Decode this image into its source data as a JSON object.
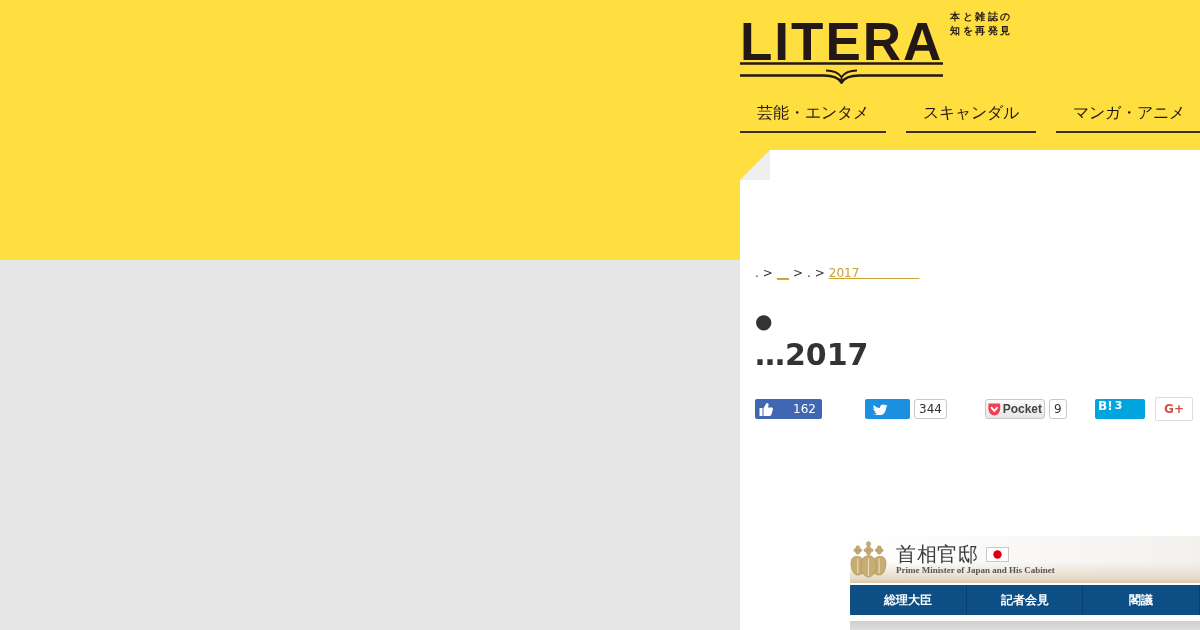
{
  "header": {
    "logo": {
      "text": "LITERA",
      "tagline": "本と雑誌の知を再発見"
    },
    "nav": [
      {
        "label": "芸能・エンタメ"
      },
      {
        "label": "スキャンダル"
      },
      {
        "label": "マンガ・アニメ"
      }
    ]
  },
  "article": {
    "breadcrumb": [
      {
        "kind": "text",
        "text": "."
      },
      {
        "kind": "separator",
        "text": ">"
      },
      {
        "kind": "link",
        "text": "__"
      },
      {
        "kind": "separator",
        "text": ">"
      },
      {
        "kind": "text",
        "text": "."
      },
      {
        "kind": "separator",
        "text": ">"
      },
      {
        "kind": "link",
        "text": "2017　　　　　"
      }
    ],
    "title": "● …2017",
    "share_buttons": [
      {
        "kind": "facebook",
        "count": "162"
      },
      {
        "kind": "twitter",
        "count": "344"
      },
      {
        "kind": "pocket",
        "label": "Pocket",
        "count": "9"
      },
      {
        "kind": "hatena",
        "label": "B!",
        "count": "3"
      },
      {
        "kind": "googleplus",
        "label": "G+"
      }
    ],
    "embedded_screenshot": {
      "title": "首相官邸",
      "subtitle": "Prime Minister of Japan and His Cabinet",
      "nav": [
        {
          "label": "総理大臣"
        },
        {
          "label": "記者会見"
        },
        {
          "label": "閣議"
        }
      ]
    }
  }
}
